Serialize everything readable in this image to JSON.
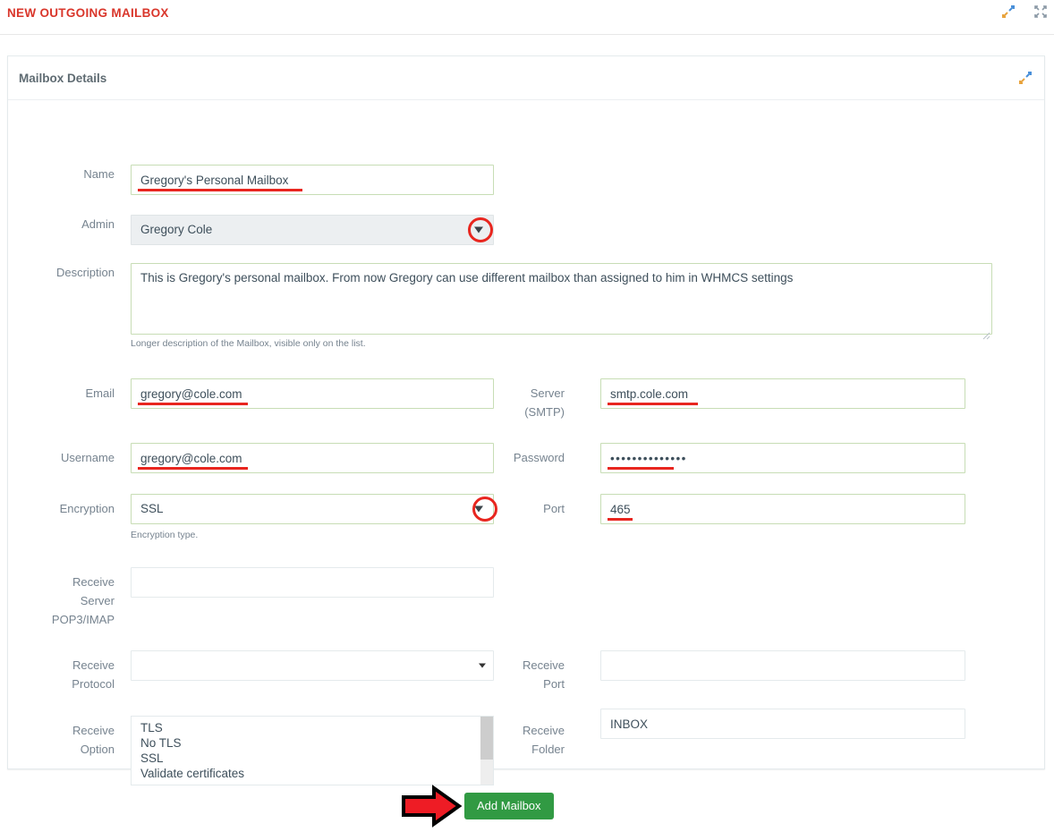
{
  "topbar": {
    "title": "NEW OUTGOING MAILBOX",
    "icons": [
      {
        "name": "collapse-icon",
        "label": "collapse"
      },
      {
        "name": "expand-icon",
        "label": "expand"
      }
    ]
  },
  "panel": {
    "title": "Mailbox Details",
    "collapse_icon": "collapse-icon"
  },
  "form": {
    "name": {
      "label": "Name",
      "value": "Gregory's Personal Mailbox",
      "placeholder": ""
    },
    "admin": {
      "label": "Admin",
      "value": "Gregory Cole",
      "options": [
        "Gregory Cole"
      ]
    },
    "description": {
      "label": "Description",
      "value": "This is Gregory's personal mailbox. From now Gregory can use different mailbox than assigned to him in WHMCS settings",
      "placeholder": "",
      "helper": "Longer description of the Mailbox, visible only on the list."
    },
    "email": {
      "label": "Email",
      "value": "gregory@cole.com",
      "placeholder": ""
    },
    "server_smtp": {
      "label": "Server (SMTP)",
      "label_line1": "Server",
      "label_line2": "(SMTP)",
      "value": "smtp.cole.com",
      "placeholder": ""
    },
    "username": {
      "label": "Username",
      "value": "gregory@cole.com",
      "placeholder": ""
    },
    "password": {
      "label": "Password",
      "value": "••••••••••••••",
      "placeholder": ""
    },
    "encryption": {
      "label": "Encryption",
      "value": "SSL",
      "options": [
        "SSL"
      ],
      "helper": "Encryption type."
    },
    "port": {
      "label": "Port",
      "value": "465",
      "placeholder": ""
    },
    "receive_server": {
      "label": "Receive Server POP3/IMAP",
      "label_line1": "Receive",
      "label_line2": "Server",
      "label_line3": "POP3/IMAP",
      "value": "",
      "placeholder": ""
    },
    "receive_protocol": {
      "label": "Receive Protocol",
      "label_line1": "Receive",
      "label_line2": "Protocol",
      "value": "",
      "options": [
        ""
      ]
    },
    "receive_port": {
      "label": "Receive Port",
      "label_line1": "Receive",
      "label_line2": "Port",
      "value": "",
      "placeholder": ""
    },
    "receive_option": {
      "label": "Receive Option",
      "label_line1": "Receive",
      "label_line2": "Option",
      "options": [
        "TLS",
        "No TLS",
        "SSL",
        "Validate certificates"
      ]
    },
    "receive_folder": {
      "label": "Receive Folder",
      "label_line1": "Receive",
      "label_line2": "Folder",
      "value": "INBOX",
      "placeholder": ""
    }
  },
  "footer": {
    "submit_label": "Add Mailbox"
  },
  "colors": {
    "title_red": "#d9362b",
    "annotation_red": "#e8261f",
    "button_green": "#319a43",
    "valid_border_green": "#c7ddb5",
    "label_grey": "#76838f"
  }
}
